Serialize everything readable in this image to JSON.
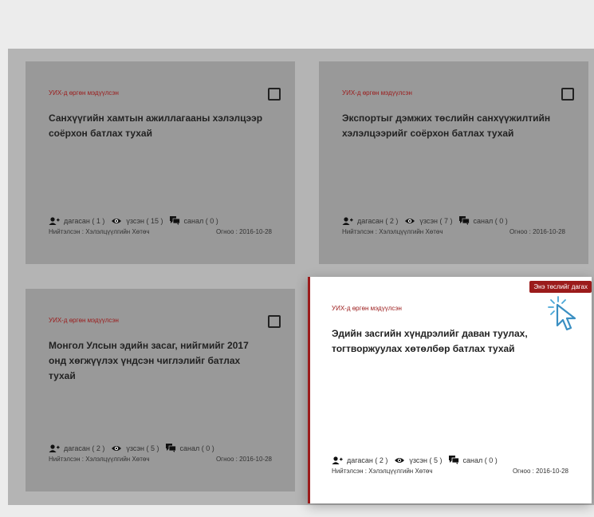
{
  "cards": [
    {
      "category": "УИХ-д өргөн мэдүүлсэн",
      "title": "Санхүүгийн хамтын ажиллагааны хэлэлцээр соёрхон батлах тухай",
      "followers": "дагасан ( 1 )",
      "views": "үзсэн ( 15 )",
      "comments": "санал ( 0 )",
      "publisher": "Нийтэлсэн : Хэлэлцүүлгийн Хөтөч",
      "date": "Огноо : 2016-10-28"
    },
    {
      "category": "УИХ-д өргөн мэдүүлсэн",
      "title": "Экспортыг дэмжих төслийн санхүүжилтийн хэлэлцээрийг соёрхон батлах тухай",
      "followers": "дагасан ( 2 )",
      "views": "үзсэн ( 7 )",
      "comments": "санал ( 0 )",
      "publisher": "Нийтэлсэн : Хэлэлцүүлгийн Хөтөч",
      "date": "Огноо : 2016-10-28"
    },
    {
      "category": "УИХ-д өргөн мэдүүлсэн",
      "title": "Монгол Улсын эдийн засаг, нийгмийг 2017 онд хөгжүүлэх үндсэн чиглэлийг батлах тухай",
      "followers": "дагасан ( 2 )",
      "views": "үзсэн ( 5 )",
      "comments": "санал ( 0 )",
      "publisher": "Нийтэлсэн : Хэлэлцүүлгийн Хөтөч",
      "date": "Огноо : 2016-10-28"
    },
    {
      "category": "УИХ-д өргөн мэдүүлсэн",
      "title": "Эдийн засгийн хүндрэлийг даван туулах, тогтворжуулах хөтөлбөр батлах тухай",
      "followers": "дагасан ( 2 )",
      "views": "үзсэн ( 5 )",
      "comments": "санал ( 0 )",
      "publisher": "Нийтэлсэн : Хэлэлцүүлгийн Хөтөч",
      "date": "Огноо : 2016-10-28",
      "badge": "Энэ төслийг дагах"
    }
  ],
  "colors": {
    "accent": "#9b1b1b",
    "card_inactive": "#999999",
    "backdrop": "#b4b4b4"
  },
  "icons": {
    "followers": "user-plus-icon",
    "views": "eye-icon",
    "comments": "comments-icon",
    "cursor": "click-cursor-icon",
    "select": "checkbox"
  }
}
